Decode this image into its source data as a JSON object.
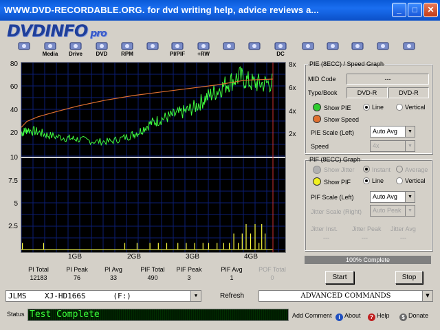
{
  "window": {
    "title": "WWW.DVD-RECORDABLE.ORG.   for dvd writing help, advice reviews a...",
    "min": "_",
    "max": "□",
    "close": "✕"
  },
  "app": {
    "logo": "DVDINFO",
    "logo_suffix": "pro"
  },
  "toolbar": [
    {
      "label": "",
      "icon": "monitor-icon"
    },
    {
      "label": "Media",
      "icon": "media-icon"
    },
    {
      "label": "Drive",
      "icon": "drive-icon"
    },
    {
      "label": "DVD",
      "icon": "dvd-icon"
    },
    {
      "label": "RPM",
      "icon": "rpm-icon"
    },
    {
      "label": "",
      "icon": "scan-icon"
    },
    {
      "label": "PI/PIF",
      "icon": "pipif-icon"
    },
    {
      "label": "+RW",
      "icon": "rw-icon"
    },
    {
      "label": "",
      "icon": "eraser-icon"
    },
    {
      "label": "",
      "icon": "wave-icon"
    },
    {
      "label": "DC",
      "icon": "dc-icon"
    },
    {
      "label": "",
      "icon": "notepad-icon"
    },
    {
      "label": "",
      "icon": "camera-icon"
    },
    {
      "label": "",
      "icon": "edit-icon"
    },
    {
      "label": "",
      "icon": "play-pause-icon"
    },
    {
      "label": "",
      "icon": "stop-icon"
    }
  ],
  "chart_data": [
    {
      "type": "line",
      "title": "",
      "y_left_ticks": [
        "80",
        "60",
        "40",
        "20"
      ],
      "y_right_ticks": [
        "8x",
        "6x",
        "4x",
        "2x"
      ],
      "ylim": [
        0,
        80
      ],
      "xlim": [
        0,
        4.5
      ],
      "series": [
        {
          "name": "PIE",
          "color": "#40ff40",
          "x": [
            0,
            0.1,
            0.3,
            0.5,
            0.8,
            1.0,
            1.3,
            1.6,
            1.9,
            2.1,
            2.3,
            2.5,
            2.7,
            2.9,
            3.1,
            3.3,
            3.5,
            3.7,
            3.9,
            4.1,
            4.3,
            4.5
          ],
          "y": [
            20,
            23,
            21,
            18,
            16,
            15,
            13,
            13,
            17,
            21,
            28,
            32,
            35,
            38,
            42,
            50,
            56,
            63,
            68,
            63,
            62,
            63
          ]
        },
        {
          "name": "Speed",
          "color": "#e07030",
          "x": [
            0,
            0.1,
            0.3,
            0.6,
            1.0,
            1.5,
            2.0,
            2.5,
            3.0,
            3.5,
            4.0,
            4.5
          ],
          "y": [
            2.5,
            3.0,
            3.4,
            3.8,
            4.3,
            4.8,
            5.2,
            5.5,
            5.8,
            6.1,
            6.5,
            6.6
          ]
        }
      ]
    },
    {
      "type": "bar",
      "title": "",
      "y_ticks": [
        "10",
        "7.5",
        "5",
        "2.5"
      ],
      "ylim": [
        0,
        10
      ],
      "x_ticks": [
        "1GB",
        "2GB",
        "3GB",
        "4GB"
      ],
      "series": [
        {
          "name": "PIF",
          "color": "#ffff40",
          "x": [
            0.02,
            0.4,
            1.85,
            2.07,
            2.3,
            2.45,
            2.6,
            2.8,
            2.95,
            3.1,
            3.25,
            3.35,
            3.5,
            3.62,
            3.72,
            3.8,
            3.88,
            3.95,
            4.02,
            4.1,
            4.18,
            4.25,
            4.3,
            4.36
          ],
          "y": [
            1,
            1,
            1,
            1,
            1,
            1,
            1,
            1,
            1,
            1,
            1,
            1,
            1,
            1,
            1,
            2,
            1,
            2,
            3,
            2,
            3,
            1,
            3,
            2
          ]
        }
      ]
    }
  ],
  "stats": [
    {
      "label": "PI Total",
      "value": "12183",
      "dim": false
    },
    {
      "label": "PI Peak",
      "value": "76",
      "dim": false
    },
    {
      "label": "PI Avg",
      "value": "33",
      "dim": false
    },
    {
      "label": "PIF Total",
      "value": "490",
      "dim": false
    },
    {
      "label": "PIF Peak",
      "value": "3",
      "dim": false
    },
    {
      "label": "PIF Avg",
      "value": "1",
      "dim": false
    },
    {
      "label": "POF Total",
      "value": "0",
      "dim": true
    }
  ],
  "pie": {
    "title": "PIE (8ECC) / Speed Graph",
    "mid_label": "MID Code",
    "mid_value": "---",
    "type_label": "Type/Book",
    "type_value": "DVD-R",
    "book_value": "DVD-R",
    "show_pie": "Show PIE",
    "show_speed": "Show Speed",
    "line": "Line",
    "vertical": "Vertical",
    "scale_label": "PIE Scale (Left)",
    "scale_value": "Auto Avg",
    "speed_label": "Speed",
    "speed_value": "4x",
    "pie_color": "#2ecc2e",
    "speed_color": "#e07030"
  },
  "pif": {
    "title": "PIF (8ECC) Graph",
    "show_jitter": "Show Jitter",
    "instant": "Instant",
    "average": "Average",
    "show_pif": "Show PIF",
    "line": "Line",
    "vertical": "Vertical",
    "scale_label": "PIF Scale (Left)",
    "scale_value": "Auto Avg",
    "jitter_label": "Jitter Scale (Right)",
    "jitter_value": "Auto Peak",
    "jitter_inst": "Jitter Inst.",
    "jitter_peak": "Jitter Peak",
    "jitter_avg": "Jitter Avg",
    "dash1": "---",
    "dash2": "---",
    "dash3": "---",
    "pif_color": "#f0f020"
  },
  "progress": {
    "text": "100% Complete",
    "percent": 100
  },
  "buttons": {
    "start": "Start",
    "stop": "Stop",
    "refresh": "Refresh"
  },
  "drive": "JLMS    XJ-HD166S      (F:)",
  "advanced": "ADVANCED COMMANDS",
  "status": {
    "label": "Status",
    "text": "Test Complete"
  },
  "bottom": {
    "add_comment": "Add Comment",
    "about": "About",
    "help": "Help",
    "donate": "Donate"
  }
}
